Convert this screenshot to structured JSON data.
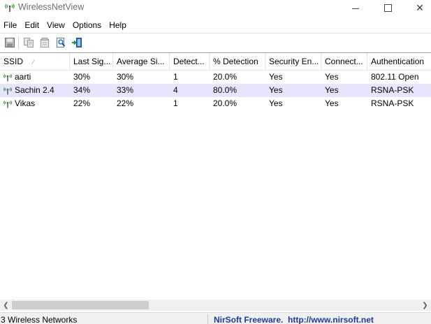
{
  "window": {
    "title": "WirelessNetView",
    "controls": {
      "minimize": "minimize",
      "maximize": "maximize",
      "close": "✕"
    }
  },
  "menu": [
    "File",
    "Edit",
    "View",
    "Options",
    "Help"
  ],
  "toolbar": {
    "buttons": [
      {
        "icon": "save-icon"
      },
      {
        "icon": "copy-icon"
      },
      {
        "icon": "properties-icon"
      },
      {
        "icon": "find-icon"
      },
      {
        "icon": "exit-icon"
      }
    ]
  },
  "table": {
    "columns": [
      "SSID",
      "Last Sig...",
      "Average Si...",
      "Detect...",
      "% Detection",
      "Security En...",
      "Connect...",
      "Authentication"
    ],
    "sorted_column_index": 0,
    "selected_row": 1,
    "rows": [
      [
        "aarti",
        "30%",
        "30%",
        "1",
        "20.0%",
        "Yes",
        "Yes",
        "802.11 Open"
      ],
      [
        "Sachin 2.4",
        "34%",
        "33%",
        "4",
        "80.0%",
        "Yes",
        "Yes",
        "RSNA-PSK"
      ],
      [
        "Vikas",
        "22%",
        "22%",
        "1",
        "20.0%",
        "Yes",
        "Yes",
        "RSNA-PSK"
      ]
    ]
  },
  "status": {
    "count_text": "3 Wireless Networks",
    "credit_text": "NirSoft Freeware.  http://www.nirsoft.net"
  },
  "colors": {
    "selected_row": "#e5e5fb",
    "credit_link": "#1d3b9f",
    "wifi_icon_green": "#2e9e2e"
  }
}
